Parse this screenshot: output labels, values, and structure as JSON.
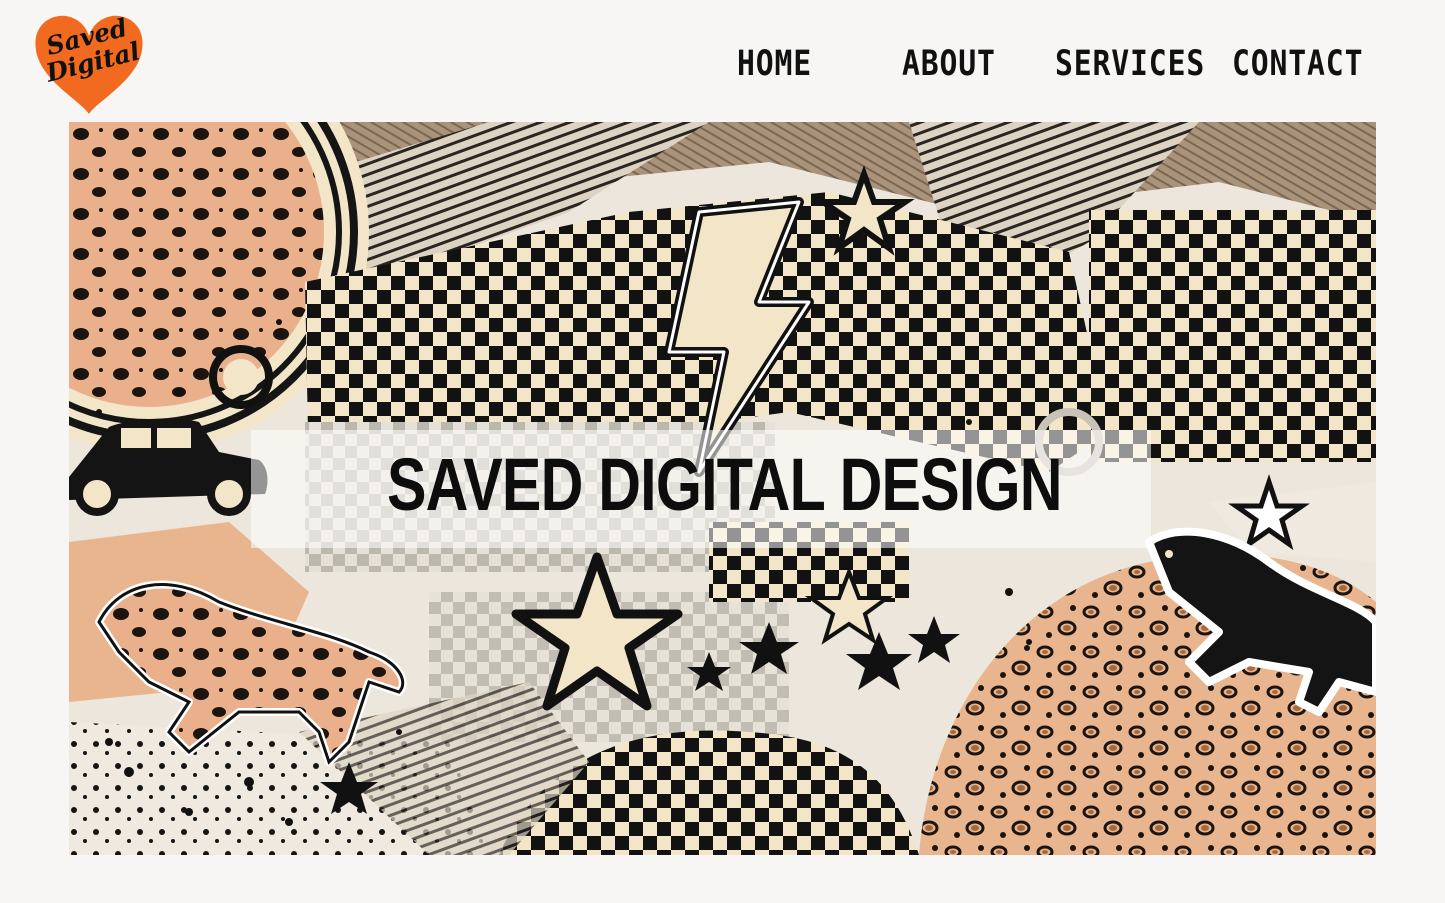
{
  "logo": {
    "line1": "Saved",
    "line2": "Digital",
    "color": "#f26a1f"
  },
  "nav": {
    "items": [
      {
        "label": "HOME"
      },
      {
        "label": "ABOUT"
      },
      {
        "label": "SERVICES"
      },
      {
        "label": "CONTACT"
      }
    ]
  },
  "hero": {
    "title": "SAVED DIGITAL DESIGN",
    "image": "collage of checkerboard, lightning bolt, stars, vintage car and leopards"
  },
  "colors": {
    "background": "#f7f6f4",
    "text": "#111111",
    "cream": "#f3e6c8",
    "peach": "#e8b58e",
    "tan": "#c9b08a"
  }
}
